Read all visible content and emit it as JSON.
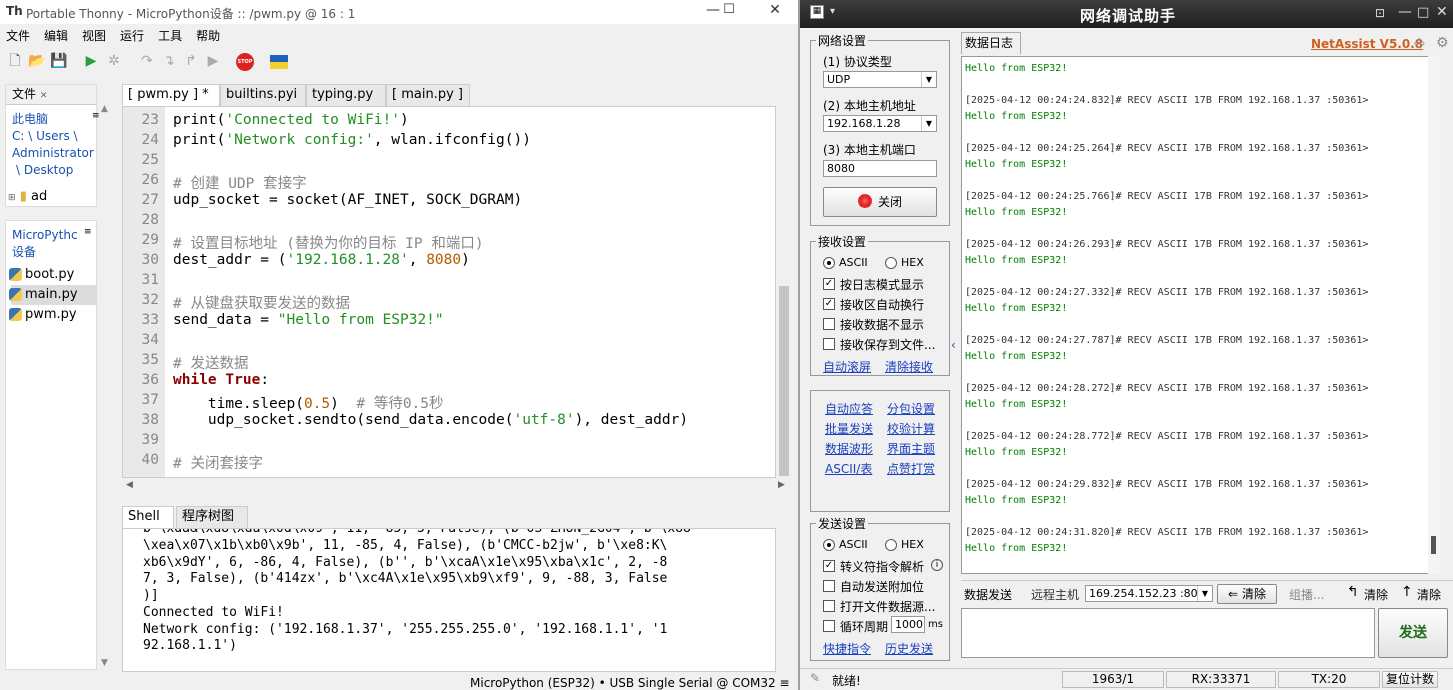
{
  "thonny": {
    "title": "Portable Thonny  -  MicroPython设备 :: /pwm.py  @  16 : 1",
    "menu": [
      "文件",
      "编辑",
      "视图",
      "运行",
      "工具",
      "帮助"
    ],
    "files_panel": {
      "tab": "文件",
      "location": [
        "此电脑",
        "C: \\ Users \\",
        "Administrator",
        "\\ Desktop"
      ],
      "folder": "ad"
    },
    "device_panel": {
      "title": [
        "MicroPythc",
        "设备"
      ],
      "files": [
        "boot.py",
        "main.py",
        "pwm.py"
      ],
      "selected": "main.py"
    },
    "editor_tabs": [
      "[ pwm.py ] *",
      "builtins.pyi",
      "typing.py",
      "[ main.py ]"
    ],
    "code_lines": [
      {
        "n": "23",
        "segs": [
          [
            "",
            "print("
          ],
          [
            "str",
            "'Connected to WiFi!'"
          ],
          [
            "",
            ")"
          ]
        ]
      },
      {
        "n": "24",
        "segs": [
          [
            "",
            "print("
          ],
          [
            "str",
            "'Network config:'"
          ],
          [
            "",
            ", wlan.ifconfig())"
          ]
        ]
      },
      {
        "n": "25",
        "segs": []
      },
      {
        "n": "26",
        "segs": [
          [
            "cmt",
            "# 创建 UDP 套接字"
          ]
        ]
      },
      {
        "n": "27",
        "segs": [
          [
            "",
            "udp_socket = socket(AF_INET, SOCK_DGRAM)"
          ]
        ]
      },
      {
        "n": "28",
        "segs": []
      },
      {
        "n": "29",
        "segs": [
          [
            "cmt",
            "# 设置目标地址 (替换为你的目标 IP 和端口)"
          ]
        ]
      },
      {
        "n": "30",
        "segs": [
          [
            "",
            "dest_addr = ("
          ],
          [
            "str",
            "'192.168.1.28'"
          ],
          [
            "",
            ", "
          ],
          [
            "num",
            "8080"
          ],
          [
            "",
            ")"
          ]
        ]
      },
      {
        "n": "31",
        "segs": []
      },
      {
        "n": "32",
        "segs": [
          [
            "cmt",
            "# 从键盘获取要发送的数据"
          ]
        ]
      },
      {
        "n": "33",
        "segs": [
          [
            "",
            "send_data = "
          ],
          [
            "str",
            "\"Hello from ESP32!\""
          ]
        ]
      },
      {
        "n": "34",
        "segs": []
      },
      {
        "n": "35",
        "segs": [
          [
            "cmt",
            "# 发送数据"
          ]
        ]
      },
      {
        "n": "36",
        "segs": [
          [
            "kw",
            "while True"
          ],
          [
            "",
            ":"
          ]
        ]
      },
      {
        "n": "37",
        "segs": [
          [
            "",
            "    time.sleep("
          ],
          [
            "num",
            "0.5"
          ],
          [
            "",
            ")  "
          ],
          [
            "cmt",
            "# 等待0.5秒"
          ]
        ]
      },
      {
        "n": "38",
        "segs": [
          [
            "",
            "    udp_socket.sendto(send_data.encode("
          ],
          [
            "str",
            "'utf-8'"
          ],
          [
            "",
            "), dest_addr)"
          ]
        ]
      },
      {
        "n": "39",
        "segs": []
      },
      {
        "n": "40",
        "segs": [
          [
            "cmt",
            "# 关闭套接字"
          ]
        ]
      }
    ],
    "shell_tabs": [
      "Shell",
      "程序树图"
    ],
    "shell_lines": [
      "\\xea\\x07\\x1b\\xb0\\x9b', 11, -85, 4, False), (b'CMCC-b2jw', b'\\xe8:K\\",
      "xb6\\x9dY', 6, -86, 4, False), (b'', b'\\xcaA\\x1e\\x95\\xba\\x1c', 2, -8",
      "7, 3, False), (b'414zx', b'\\xc4A\\x1e\\x95\\xb9\\xf9', 9, -88, 3, False",
      ")]",
      "Connected to WiFi!",
      "Network config: ('192.168.1.37', '255.255.255.0', '192.168.1.1', '1",
      "92.168.1.1')"
    ],
    "status": "MicroPython (ESP32)  •  USB Single Serial @ COM32  ≡"
  },
  "netassist": {
    "title": "网络调试助手",
    "brand": "NetAssist V5.0.8",
    "net_settings": {
      "group": "网络设置",
      "protocol_label": "(1) 协议类型",
      "protocol": "UDP",
      "host_label": "(2) 本地主机地址",
      "host": "192.168.1.28",
      "port_label": "(3) 本地主机端口",
      "port": "8080",
      "close_button": "关闭"
    },
    "recv_settings": {
      "group": "接收设置",
      "ascii": "ASCII",
      "hex": "HEX",
      "options": [
        {
          "label": "按日志模式显示",
          "checked": true
        },
        {
          "label": "接收区自动换行",
          "checked": true
        },
        {
          "label": "接收数据不显示",
          "checked": false
        },
        {
          "label": "接收保存到文件...",
          "checked": false
        }
      ],
      "auto_scroll": "自动滚屏",
      "clear_recv": "清除接收"
    },
    "tools": [
      [
        "自动应答",
        "分包设置"
      ],
      [
        "批量发送",
        "校验计算"
      ],
      [
        "数据波形",
        "界面主题"
      ],
      [
        "ASCII/表",
        "点赞打赏"
      ]
    ],
    "send_settings": {
      "group": "发送设置",
      "ascii": "ASCII",
      "hex": "HEX",
      "options": [
        {
          "label": "转义符指令解析",
          "checked": true
        },
        {
          "label": "自动发送附加位",
          "checked": false
        },
        {
          "label": "打开文件数据源...",
          "checked": false
        },
        {
          "label": "循环周期",
          "checked": false
        }
      ],
      "period": "1000",
      "period_unit": "ms",
      "shortcut": "快捷指令",
      "history": "历史发送"
    },
    "log_tab": "数据日志",
    "log_first": "Hello from ESP32!",
    "log_entries": [
      {
        "head": "[2025-04-12 00:24:24.832]# RECV ASCII 17B FROM 192.168.1.37 :50361>",
        "msg": "Hello from ESP32!"
      },
      {
        "head": "[2025-04-12 00:24:25.264]# RECV ASCII 17B FROM 192.168.1.37 :50361>",
        "msg": "Hello from ESP32!"
      },
      {
        "head": "[2025-04-12 00:24:25.766]# RECV ASCII 17B FROM 192.168.1.37 :50361>",
        "msg": "Hello from ESP32!"
      },
      {
        "head": "[2025-04-12 00:24:26.293]# RECV ASCII 17B FROM 192.168.1.37 :50361>",
        "msg": "Hello from ESP32!"
      },
      {
        "head": "[2025-04-12 00:24:27.332]# RECV ASCII 17B FROM 192.168.1.37 :50361>",
        "msg": "Hello from ESP32!"
      },
      {
        "head": "[2025-04-12 00:24:27.787]# RECV ASCII 17B FROM 192.168.1.37 :50361>",
        "msg": "Hello from ESP32!"
      },
      {
        "head": "[2025-04-12 00:24:28.272]# RECV ASCII 17B FROM 192.168.1.37 :50361>",
        "msg": "Hello from ESP32!"
      },
      {
        "head": "[2025-04-12 00:24:28.772]# RECV ASCII 17B FROM 192.168.1.37 :50361>",
        "msg": "Hello from ESP32!"
      },
      {
        "head": "[2025-04-12 00:24:29.832]# RECV ASCII 17B FROM 192.168.1.37 :50361>",
        "msg": "Hello from ESP32!"
      },
      {
        "head": "[2025-04-12 00:24:31.820]# RECV ASCII 17B FROM 192.168.1.37 :50361>",
        "msg": "Hello from ESP32!"
      }
    ],
    "send_bar": {
      "label": "数据发送",
      "remote_label": "远程主机",
      "remote": "169.254.152.23 :80",
      "clear1": "清除",
      "group": "组播...",
      "clear2": "清除",
      "clear3": "清除"
    },
    "send_button": "发送",
    "status": {
      "ready": "就绪!",
      "counter": "1963/1",
      "rx": "RX:33371",
      "tx": "TX:20",
      "reset": "复位计数"
    }
  }
}
